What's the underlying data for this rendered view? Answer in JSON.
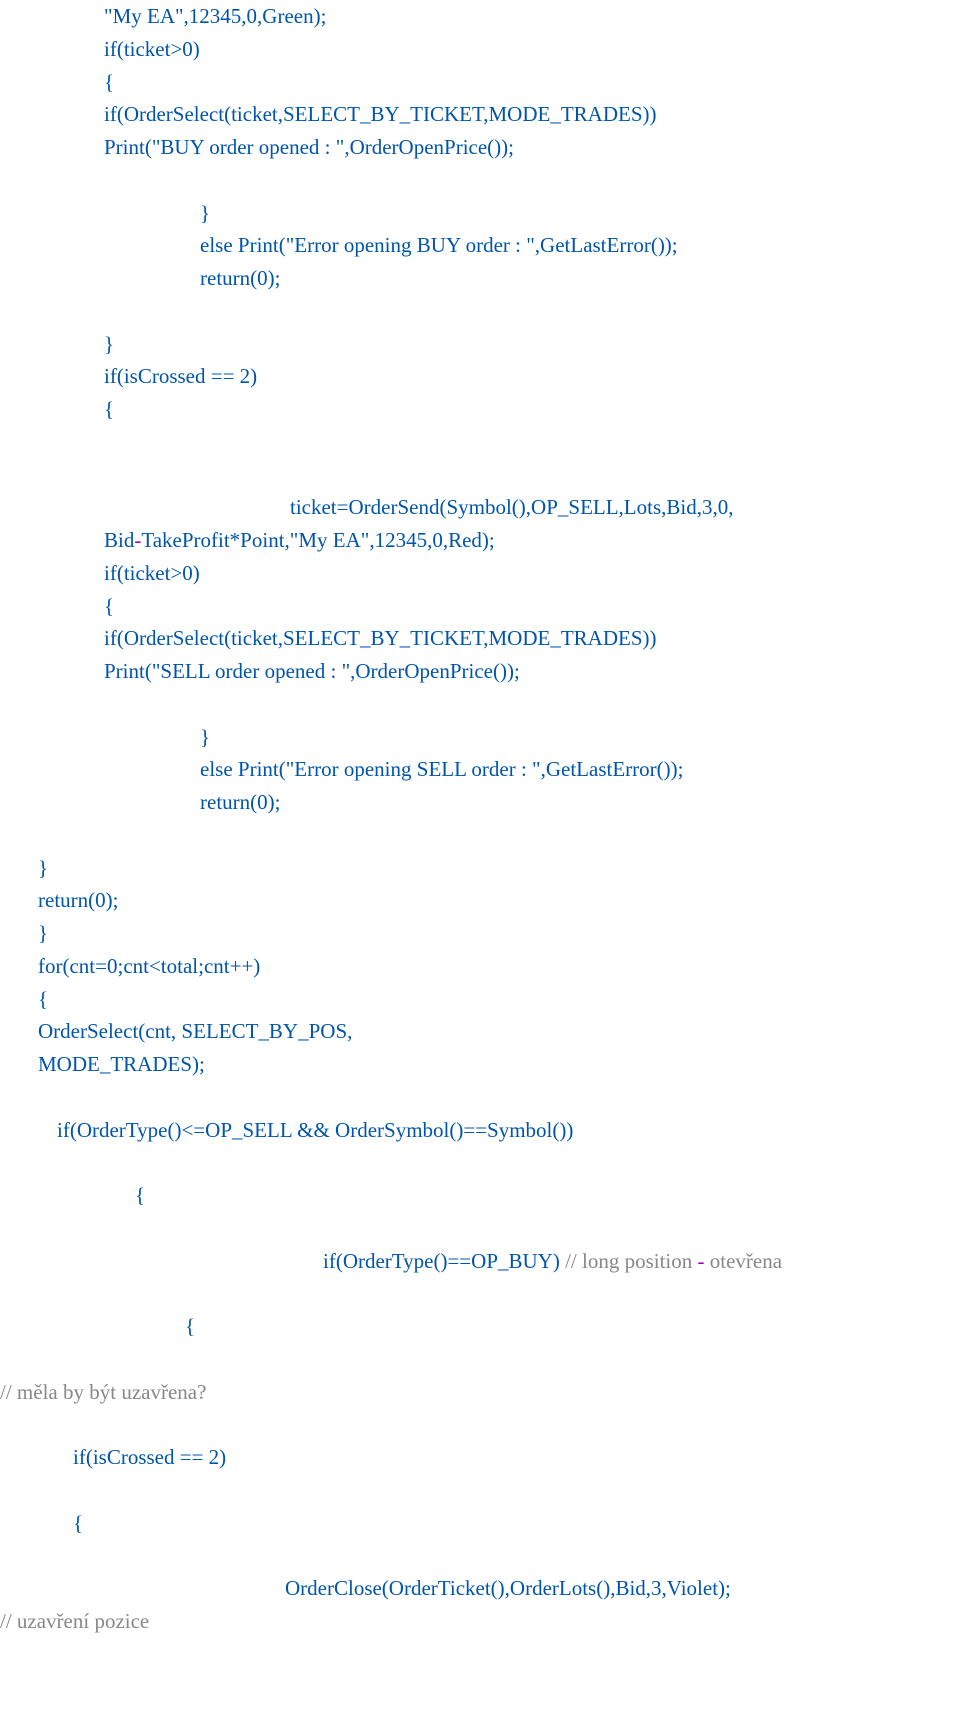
{
  "colors": {
    "blue": "#0055aa",
    "purple": "#9900cc",
    "gray": "#888888",
    "black": "#000000"
  },
  "lines": [
    {
      "indent": 104,
      "spans": [
        {
          "c": "blue",
          "t": "\"My EA\",12345,0,Green);"
        }
      ]
    },
    {
      "indent": 104,
      "spans": [
        {
          "c": "blue",
          "t": "if(ticket>0)"
        }
      ]
    },
    {
      "indent": 104,
      "spans": [
        {
          "c": "blue",
          "t": "{"
        }
      ]
    },
    {
      "indent": 104,
      "spans": [
        {
          "c": "blue",
          "t": "if(OrderSelect(ticket,SELECT_BY_TICKET,MODE_TRADES))"
        }
      ]
    },
    {
      "indent": 104,
      "spans": [
        {
          "c": "blue",
          "t": "Print(\"BUY order opened : \",OrderOpenPrice());"
        }
      ]
    },
    {
      "indent": 0,
      "spans": [
        {
          "c": "blue",
          "t": " "
        }
      ]
    },
    {
      "indent": 200,
      "spans": [
        {
          "c": "blue",
          "t": "}"
        }
      ]
    },
    {
      "indent": 200,
      "spans": [
        {
          "c": "blue",
          "t": "else Print(\"Error opening BUY order : \",GetLastError());"
        }
      ]
    },
    {
      "indent": 200,
      "spans": [
        {
          "c": "blue",
          "t": "return(0);"
        }
      ]
    },
    {
      "indent": 0,
      "spans": [
        {
          "c": "blue",
          "t": " "
        }
      ]
    },
    {
      "indent": 104,
      "spans": [
        {
          "c": "blue",
          "t": "}"
        }
      ]
    },
    {
      "indent": 104,
      "spans": [
        {
          "c": "blue",
          "t": "if(isCrossed == 2)"
        }
      ]
    },
    {
      "indent": 104,
      "spans": [
        {
          "c": "blue",
          "t": "{"
        }
      ]
    },
    {
      "indent": 0,
      "spans": [
        {
          "c": "blue",
          "t": " "
        }
      ]
    },
    {
      "indent": 0,
      "spans": [
        {
          "c": "blue",
          "t": " "
        }
      ]
    },
    {
      "indent": 290,
      "spans": [
        {
          "c": "blue",
          "t": "ticket=OrderSend(Symbol(),OP_SELL,Lots,Bid,3,0,"
        }
      ]
    },
    {
      "indent": 104,
      "spans": [
        {
          "c": "blue",
          "t": "Bid"
        },
        {
          "c": "purple",
          "t": "-"
        },
        {
          "c": "blue",
          "t": "TakeProfit*Point,\"My EA\",12345,0,Red);"
        }
      ]
    },
    {
      "indent": 104,
      "spans": [
        {
          "c": "blue",
          "t": "if(ticket>0)"
        }
      ]
    },
    {
      "indent": 104,
      "spans": [
        {
          "c": "blue",
          "t": "{"
        }
      ]
    },
    {
      "indent": 104,
      "spans": [
        {
          "c": "blue",
          "t": "if(OrderSelect(ticket,SELECT_BY_TICKET,MODE_TRADES))"
        }
      ]
    },
    {
      "indent": 104,
      "spans": [
        {
          "c": "blue",
          "t": "Print(\"SELL order opened : \",OrderOpenPrice());"
        }
      ]
    },
    {
      "indent": 0,
      "spans": [
        {
          "c": "blue",
          "t": " "
        }
      ]
    },
    {
      "indent": 200,
      "spans": [
        {
          "c": "blue",
          "t": "}"
        }
      ]
    },
    {
      "indent": 200,
      "spans": [
        {
          "c": "blue",
          "t": "else Print(\"Error opening SELL order : \",GetLastError());"
        }
      ]
    },
    {
      "indent": 200,
      "spans": [
        {
          "c": "blue",
          "t": "return(0);"
        }
      ]
    },
    {
      "indent": 0,
      "spans": [
        {
          "c": "blue",
          "t": " "
        }
      ]
    },
    {
      "indent": 38,
      "spans": [
        {
          "c": "blue",
          "t": "}"
        }
      ]
    },
    {
      "indent": 38,
      "spans": [
        {
          "c": "blue",
          "t": "return(0);"
        }
      ]
    },
    {
      "indent": 38,
      "spans": [
        {
          "c": "blue",
          "t": "}"
        }
      ]
    },
    {
      "indent": 38,
      "spans": [
        {
          "c": "blue",
          "t": "for(cnt=0;cnt<total;cnt++)"
        }
      ]
    },
    {
      "indent": 38,
      "spans": [
        {
          "c": "blue",
          "t": "{"
        }
      ]
    },
    {
      "indent": 38,
      "spans": [
        {
          "c": "blue",
          "t": "OrderSelect(cnt, SELECT_BY_POS,"
        }
      ]
    },
    {
      "indent": 38,
      "spans": [
        {
          "c": "blue",
          "t": "MODE_TRADES);"
        }
      ]
    },
    {
      "indent": 0,
      "spans": [
        {
          "c": "blue",
          "t": " "
        }
      ]
    },
    {
      "indent": 57,
      "spans": [
        {
          "c": "blue",
          "t": "if(OrderType()<=OP_SELL && OrderSymbol()==Symbol())"
        }
      ]
    },
    {
      "indent": 0,
      "spans": [
        {
          "c": "blue",
          "t": " "
        }
      ]
    },
    {
      "indent": 135,
      "spans": [
        {
          "c": "blue",
          "t": "{"
        }
      ]
    },
    {
      "indent": 0,
      "spans": [
        {
          "c": "blue",
          "t": " "
        }
      ]
    },
    {
      "indent": 323,
      "spans": [
        {
          "c": "blue",
          "t": "if(OrderType()==OP_BUY)"
        },
        {
          "c": "gray",
          "t": " // long position "
        },
        {
          "c": "purple",
          "t": "- "
        },
        {
          "c": "gray",
          "t": "otevřena"
        }
      ]
    },
    {
      "indent": 0,
      "spans": [
        {
          "c": "blue",
          "t": " "
        }
      ]
    },
    {
      "indent": 185,
      "spans": [
        {
          "c": "blue",
          "t": "{"
        }
      ]
    },
    {
      "indent": 0,
      "spans": [
        {
          "c": "blue",
          "t": " "
        }
      ]
    },
    {
      "indent": 0,
      "spans": [
        {
          "c": "gray",
          "t": "// měla by být uzavřena?"
        }
      ]
    },
    {
      "indent": 0,
      "spans": [
        {
          "c": "blue",
          "t": " "
        }
      ]
    },
    {
      "indent": 73,
      "spans": [
        {
          "c": "blue",
          "t": "if(isCrossed == 2)"
        }
      ]
    },
    {
      "indent": 0,
      "spans": [
        {
          "c": "blue",
          "t": " "
        }
      ]
    },
    {
      "indent": 73,
      "spans": [
        {
          "c": "blue",
          "t": "{"
        }
      ]
    },
    {
      "indent": 0,
      "spans": [
        {
          "c": "blue",
          "t": " "
        }
      ]
    },
    {
      "indent": 285,
      "spans": [
        {
          "c": "blue",
          "t": "OrderClose(OrderTicket(),OrderLots(),Bid,3,Violet);"
        }
      ]
    },
    {
      "indent": 0,
      "spans": [
        {
          "c": "gray",
          "t": "// uzavření pozice"
        }
      ]
    }
  ]
}
